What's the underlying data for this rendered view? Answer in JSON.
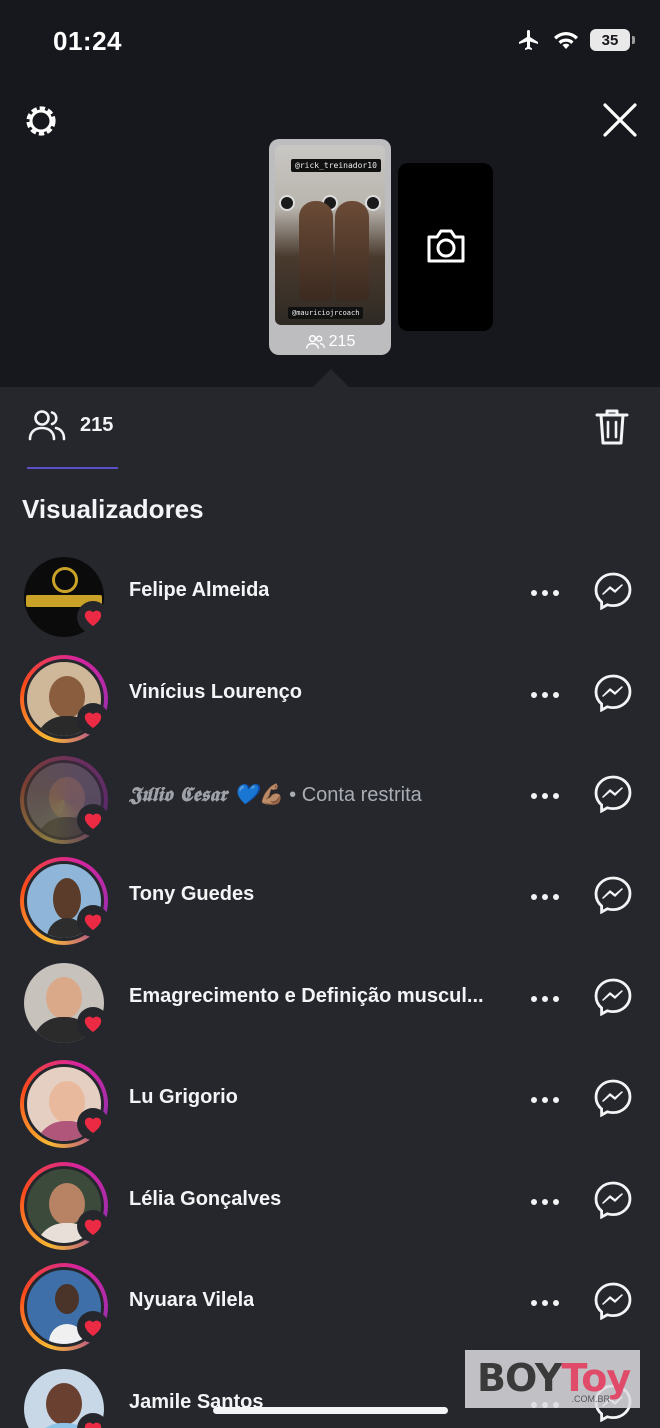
{
  "status_bar": {
    "time": "01:24",
    "battery": "35"
  },
  "story": {
    "thumb_count": "215",
    "tag_top": "@rick_treinador10",
    "tag_bottom": "@mauriciojrcoach"
  },
  "viewers_tab": {
    "count": "215"
  },
  "section_title": "Visualizadores",
  "viewers": [
    {
      "name": "Felipe Almeida",
      "restricted": ""
    },
    {
      "name": "Vinícius Lourenço",
      "restricted": ""
    },
    {
      "name": "𝕵𝖚́𝖑𝖎𝖔 𝕮𝖊𝖘𝖆𝖗 💙💪🏽",
      "restricted": " • Conta restrita"
    },
    {
      "name": "Tony Guedes",
      "restricted": ""
    },
    {
      "name": "Emagrecimento e Definição muscul...",
      "restricted": ""
    },
    {
      "name": "Lu Grigorio",
      "restricted": ""
    },
    {
      "name": "Lélia Gonçalves",
      "restricted": ""
    },
    {
      "name": "Nyuara Vilela",
      "restricted": ""
    },
    {
      "name": "Jamile Santos",
      "restricted": ""
    }
  ],
  "watermark": {
    "brand_a": "BOY",
    "brand_b": "Toy",
    "sub": ".COM.BR"
  },
  "colors": {
    "accent_underline": "#5b4fc7",
    "heart": "#ed2a43",
    "sheet": "#25272d",
    "top": "#16181d"
  }
}
